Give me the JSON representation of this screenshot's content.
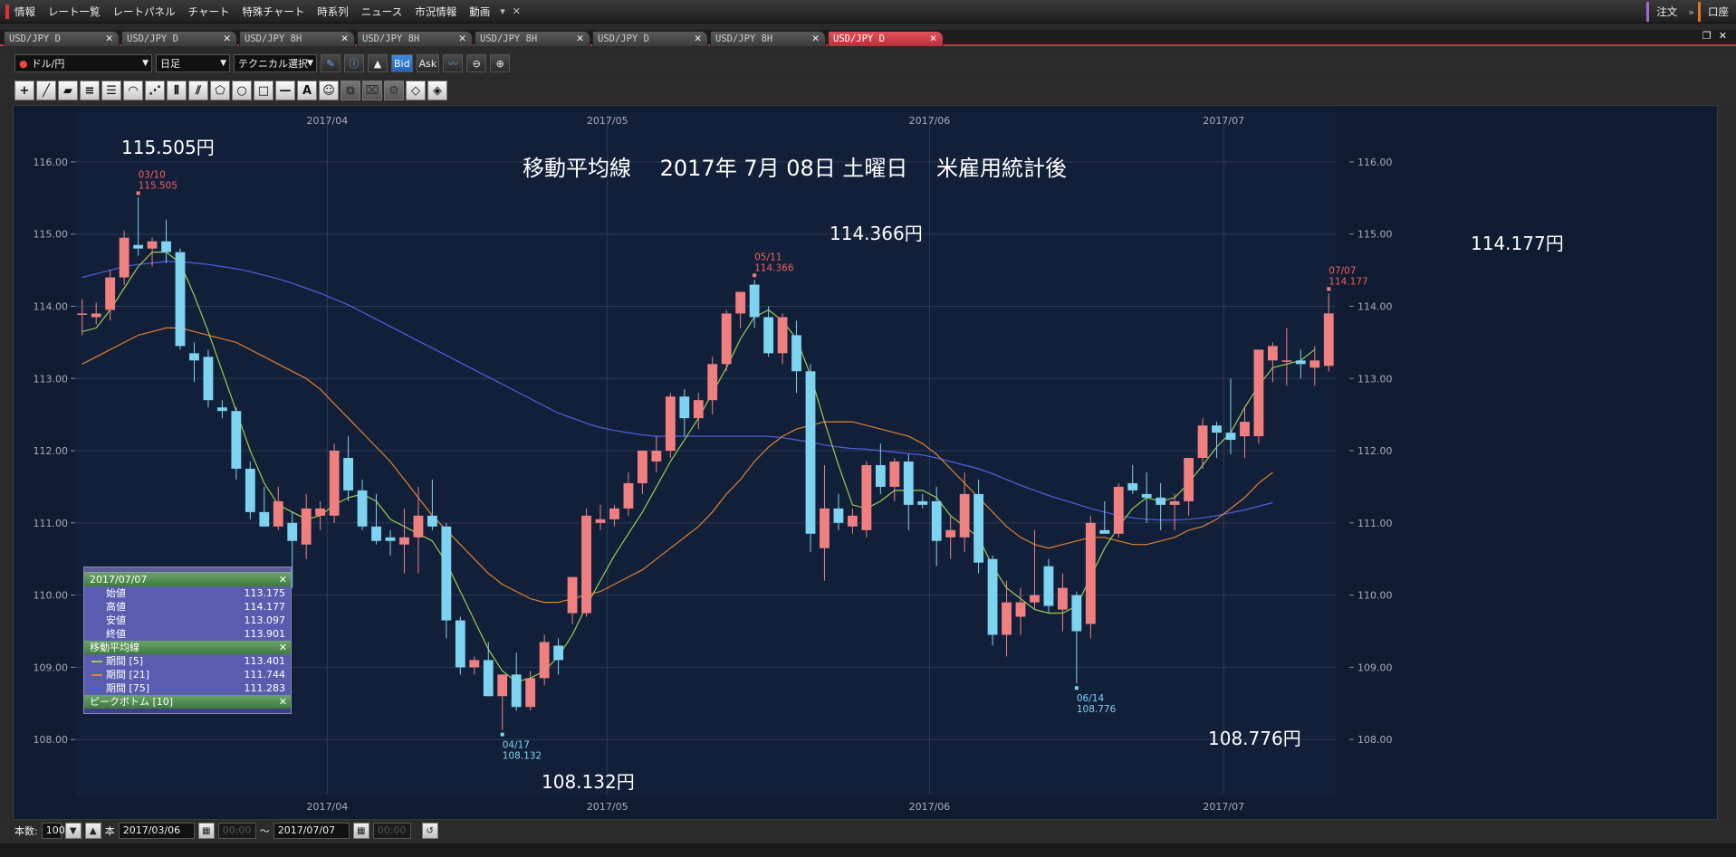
{
  "menu": {
    "items": [
      "情報",
      "レート一覧",
      "レートパネル",
      "チャート",
      "特殊チャート",
      "時系列",
      "ニュース",
      "市況情報",
      "動画"
    ],
    "right": [
      "注文",
      "口座"
    ]
  },
  "tabs": [
    "USD/JPY D",
    "USD/JPY D",
    "USD/JPY 8H",
    "USD/JPY 8H",
    "USD/JPY 8H",
    "USD/JPY D",
    "USD/JPY 8H",
    "USD/JPY D"
  ],
  "active_tab": 7,
  "toolbar": {
    "currency": "ドル/円",
    "timeframe": "日足",
    "technical": "テクニカル選択",
    "bid": "Bid",
    "ask": "Ask"
  },
  "chart_title": "移動平均線　 2017年 7月 08日 土曜日　 米雇用統計後",
  "big_labels": {
    "high1": "115.505円",
    "low1": "108.132円",
    "high2": "114.366円",
    "low2": "108.776円",
    "high3": "114.177円"
  },
  "info_panel": {
    "date": "2017/07/07",
    "ohlc": [
      {
        "label": "始値",
        "value": "113.175"
      },
      {
        "label": "高値",
        "value": "114.177"
      },
      {
        "label": "安値",
        "value": "113.097"
      },
      {
        "label": "終値",
        "value": "113.901"
      }
    ],
    "ma_title": "移動平均線",
    "ma": [
      {
        "label": "期間 [5]",
        "value": "113.401",
        "color": "#9acd50"
      },
      {
        "label": "期間 [21]",
        "value": "111.744",
        "color": "#e08030"
      },
      {
        "label": "期間 [75]",
        "value": "111.283",
        "color": "#5060e0"
      }
    ],
    "peak_title": "ピークボトム [10]"
  },
  "bottom": {
    "count_label": "本数:",
    "count": "100",
    "unit": "本",
    "from_date": "2017/03/06",
    "from_time": "00:00",
    "tilde": "〜",
    "to_date": "2017/07/07",
    "to_time": "00:00"
  },
  "chart_data": {
    "type": "candlestick",
    "ylim": [
      107.3,
      116.4
    ],
    "yticks": [
      "108.00",
      "109.00",
      "110.00",
      "111.00",
      "112.00",
      "113.00",
      "114.00",
      "115.00",
      "116.00"
    ],
    "month_labels": [
      {
        "label": "2017/04",
        "index": 18
      },
      {
        "label": "2017/05",
        "index": 38
      },
      {
        "label": "2017/06",
        "index": 61
      },
      {
        "label": "2017/07",
        "index": 82
      }
    ],
    "up_color": "#f08080",
    "down_color": "#7dd3f0",
    "candles": [
      [
        113.9,
        114.1,
        113.6,
        113.9
      ],
      [
        113.85,
        114.05,
        113.75,
        113.9
      ],
      [
        113.95,
        114.5,
        113.8,
        114.4
      ],
      [
        114.4,
        115.05,
        114.3,
        114.95
      ],
      [
        114.85,
        115.505,
        114.7,
        114.8
      ],
      [
        114.8,
        114.95,
        114.55,
        114.9
      ],
      [
        114.9,
        115.2,
        114.6,
        114.75
      ],
      [
        114.75,
        114.8,
        113.4,
        113.45
      ],
      [
        113.35,
        113.5,
        112.95,
        113.25
      ],
      [
        113.3,
        113.4,
        112.6,
        112.7
      ],
      [
        112.6,
        112.7,
        112.45,
        112.55
      ],
      [
        112.55,
        112.6,
        111.6,
        111.75
      ],
      [
        111.75,
        111.85,
        111.05,
        111.15
      ],
      [
        111.15,
        111.5,
        110.95,
        110.95
      ],
      [
        110.95,
        111.5,
        110.9,
        111.3
      ],
      [
        111.0,
        111.15,
        110.1,
        110.75
      ],
      [
        110.7,
        111.4,
        110.5,
        111.2
      ],
      [
        111.1,
        111.3,
        110.9,
        111.2
      ],
      [
        111.1,
        112.1,
        111.0,
        112.0
      ],
      [
        111.9,
        112.2,
        111.3,
        111.45
      ],
      [
        111.45,
        111.6,
        110.9,
        110.95
      ],
      [
        110.95,
        111.4,
        110.7,
        110.75
      ],
      [
        110.8,
        110.9,
        110.55,
        110.75
      ],
      [
        110.7,
        111.2,
        110.3,
        110.8
      ],
      [
        110.8,
        111.5,
        110.3,
        111.1
      ],
      [
        111.1,
        111.6,
        110.9,
        110.95
      ],
      [
        110.95,
        111.0,
        109.4,
        109.65
      ],
      [
        109.65,
        109.7,
        108.9,
        109.0
      ],
      [
        109.0,
        109.15,
        108.9,
        109.1
      ],
      [
        109.1,
        109.35,
        108.6,
        108.6
      ],
      [
        108.6,
        108.9,
        108.132,
        108.9
      ],
      [
        108.9,
        109.2,
        108.4,
        108.45
      ],
      [
        108.45,
        108.95,
        108.4,
        108.85
      ],
      [
        108.85,
        109.45,
        108.75,
        109.35
      ],
      [
        109.3,
        109.4,
        108.9,
        109.1
      ],
      [
        109.75,
        110.25,
        109.6,
        110.25
      ],
      [
        109.75,
        111.2,
        109.7,
        111.1
      ],
      [
        111.0,
        111.25,
        110.9,
        111.05
      ],
      [
        111.05,
        111.25,
        110.95,
        111.2
      ],
      [
        111.2,
        111.7,
        111.1,
        111.55
      ],
      [
        111.55,
        111.9,
        111.4,
        112.0
      ],
      [
        111.85,
        112.2,
        111.7,
        112.0
      ],
      [
        112.0,
        112.8,
        111.9,
        112.75
      ],
      [
        112.75,
        112.85,
        112.2,
        112.45
      ],
      [
        112.45,
        112.8,
        112.3,
        112.7
      ],
      [
        112.7,
        113.3,
        112.5,
        113.2
      ],
      [
        113.2,
        113.95,
        113.1,
        113.9
      ],
      [
        113.9,
        114.1,
        113.7,
        114.2
      ],
      [
        114.3,
        114.366,
        113.7,
        113.85
      ],
      [
        113.85,
        114.0,
        113.3,
        113.35
      ],
      [
        113.35,
        113.9,
        113.2,
        113.85
      ],
      [
        113.6,
        113.8,
        112.8,
        113.1
      ],
      [
        113.1,
        113.2,
        110.6,
        110.85
      ],
      [
        110.65,
        111.8,
        110.2,
        111.2
      ],
      [
        111.2,
        111.4,
        110.9,
        111.0
      ],
      [
        110.95,
        111.2,
        110.85,
        111.1
      ],
      [
        110.9,
        111.85,
        110.8,
        111.8
      ],
      [
        111.8,
        112.1,
        111.4,
        111.5
      ],
      [
        111.5,
        111.9,
        111.3,
        111.85
      ],
      [
        111.85,
        111.95,
        110.9,
        111.25
      ],
      [
        111.3,
        111.4,
        111.2,
        111.25
      ],
      [
        111.3,
        111.5,
        110.4,
        110.75
      ],
      [
        110.8,
        111.1,
        110.5,
        110.9
      ],
      [
        110.8,
        111.7,
        110.6,
        111.4
      ],
      [
        111.4,
        111.6,
        110.3,
        110.45
      ],
      [
        110.5,
        110.55,
        109.3,
        109.45
      ],
      [
        109.45,
        110.2,
        109.15,
        109.9
      ],
      [
        109.7,
        110.1,
        109.45,
        109.9
      ],
      [
        109.9,
        110.9,
        109.8,
        110.0
      ],
      [
        110.4,
        110.5,
        109.75,
        109.85
      ],
      [
        109.8,
        110.3,
        109.5,
        110.1
      ],
      [
        110.0,
        110.05,
        108.776,
        109.5
      ],
      [
        109.6,
        111.1,
        109.4,
        111.0
      ],
      [
        110.9,
        111.3,
        110.9,
        110.85
      ],
      [
        110.85,
        111.55,
        110.8,
        111.5
      ],
      [
        111.55,
        111.8,
        111.4,
        111.45
      ],
      [
        111.4,
        111.7,
        111.0,
        111.35
      ],
      [
        111.35,
        111.55,
        110.9,
        111.25
      ],
      [
        111.25,
        111.4,
        110.9,
        111.3
      ],
      [
        111.3,
        111.9,
        111.1,
        111.9
      ],
      [
        111.9,
        112.45,
        111.75,
        112.35
      ],
      [
        112.35,
        112.4,
        111.9,
        112.25
      ],
      [
        112.25,
        113.0,
        111.95,
        112.15
      ],
      [
        112.2,
        112.6,
        111.9,
        112.4
      ],
      [
        112.2,
        113.35,
        112.1,
        113.4
      ],
      [
        113.25,
        113.5,
        112.95,
        113.45
      ],
      [
        113.25,
        113.7,
        112.9,
        113.25
      ],
      [
        113.25,
        113.4,
        113.0,
        113.2
      ],
      [
        113.15,
        113.45,
        112.9,
        113.25
      ],
      [
        113.175,
        114.177,
        113.097,
        113.901
      ]
    ],
    "ma5": [
      113.65,
      113.7,
      113.95,
      114.25,
      114.55,
      114.75,
      114.75,
      114.6,
      114.15,
      113.65,
      113.1,
      112.55,
      112.0,
      111.55,
      111.25,
      111.15,
      111.05,
      111.1,
      111.25,
      111.35,
      111.4,
      111.3,
      111.05,
      110.95,
      110.85,
      110.75,
      110.45,
      110.05,
      109.65,
      109.25,
      108.95,
      108.8,
      108.85,
      108.95,
      109.15,
      109.45,
      109.85,
      110.2,
      110.55,
      110.85,
      111.15,
      111.5,
      111.85,
      112.15,
      112.45,
      112.8,
      113.15,
      113.55,
      113.85,
      113.95,
      113.8,
      113.55,
      113.05,
      112.4,
      111.8,
      111.25,
      111.2,
      111.3,
      111.45,
      111.45,
      111.45,
      111.35,
      111.1,
      110.95,
      110.8,
      110.4,
      110.1,
      109.95,
      109.8,
      109.75,
      109.75,
      109.85,
      110.25,
      110.65,
      110.95,
      111.2,
      111.35,
      111.3,
      111.35,
      111.55,
      111.8,
      112.05,
      112.25,
      112.6,
      112.9,
      113.15,
      113.2,
      113.25,
      113.4
    ],
    "ma21": [
      113.2,
      113.3,
      113.4,
      113.5,
      113.6,
      113.65,
      113.7,
      113.7,
      113.65,
      113.6,
      113.55,
      113.5,
      113.4,
      113.3,
      113.2,
      113.1,
      113.0,
      112.85,
      112.65,
      112.45,
      112.25,
      112.05,
      111.85,
      111.6,
      111.35,
      111.1,
      110.9,
      110.7,
      110.5,
      110.3,
      110.15,
      110.05,
      109.95,
      109.9,
      109.9,
      109.95,
      110.0,
      110.05,
      110.15,
      110.25,
      110.35,
      110.5,
      110.65,
      110.8,
      110.95,
      111.15,
      111.4,
      111.6,
      111.85,
      112.05,
      112.2,
      112.3,
      112.35,
      112.4,
      112.4,
      112.4,
      112.35,
      112.3,
      112.25,
      112.2,
      112.1,
      111.95,
      111.75,
      111.55,
      111.35,
      111.15,
      110.95,
      110.8,
      110.7,
      110.65,
      110.7,
      110.75,
      110.8,
      110.8,
      110.75,
      110.7,
      110.7,
      110.75,
      110.8,
      110.9,
      110.95,
      111.05,
      111.2,
      111.35,
      111.55,
      111.7
    ],
    "ma75": [
      114.4,
      114.45,
      114.5,
      114.55,
      114.58,
      114.6,
      114.62,
      114.62,
      114.6,
      114.58,
      114.55,
      114.52,
      114.48,
      114.43,
      114.38,
      114.32,
      114.25,
      114.18,
      114.1,
      114.02,
      113.92,
      113.82,
      113.72,
      113.62,
      113.52,
      113.42,
      113.32,
      113.22,
      113.12,
      113.02,
      112.92,
      112.82,
      112.72,
      112.62,
      112.52,
      112.45,
      112.38,
      112.32,
      112.28,
      112.25,
      112.22,
      112.2,
      112.2,
      112.2,
      112.2,
      112.2,
      112.2,
      112.2,
      112.2,
      112.2,
      112.18,
      112.15,
      112.12,
      112.08,
      112.05,
      112.03,
      112.02,
      112.0,
      111.98,
      111.96,
      111.94,
      111.9,
      111.85,
      111.8,
      111.75,
      111.68,
      111.6,
      111.52,
      111.45,
      111.38,
      111.32,
      111.26,
      111.2,
      111.15,
      111.1,
      111.07,
      111.05,
      111.04,
      111.04,
      111.05,
      111.07,
      111.1,
      111.14,
      111.18,
      111.23,
      111.28
    ],
    "peaks": [
      {
        "index": 4,
        "date": "03/10",
        "value": "115.505",
        "type": "high"
      },
      {
        "index": 30,
        "date": "04/17",
        "value": "108.132",
        "type": "low"
      },
      {
        "index": 48,
        "date": "05/11",
        "value": "114.366",
        "type": "high"
      },
      {
        "index": 71,
        "date": "06/14",
        "value": "108.776",
        "type": "low"
      },
      {
        "index": 89,
        "date": "07/07",
        "value": "114.177",
        "type": "high"
      }
    ]
  }
}
